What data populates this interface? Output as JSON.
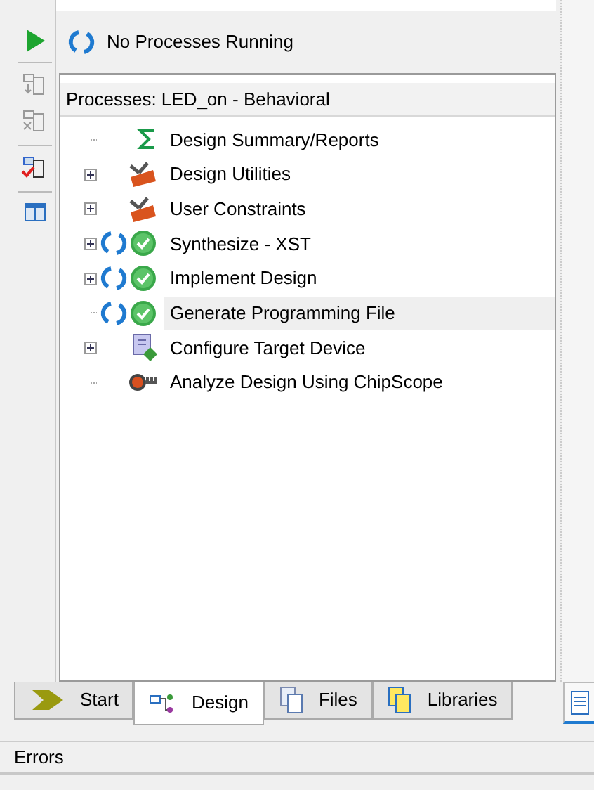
{
  "status": {
    "text": "No Processes Running"
  },
  "processes": {
    "title": "Processes:",
    "design": "LED_on - Behavioral",
    "items": [
      {
        "label": "Design Summary/Reports",
        "kind": "summary",
        "expandable": false,
        "selected": false
      },
      {
        "label": "Design Utilities",
        "kind": "tools",
        "expandable": true,
        "selected": false
      },
      {
        "label": "User Constraints",
        "kind": "tools",
        "expandable": true,
        "selected": false
      },
      {
        "label": "Synthesize - XST",
        "kind": "done",
        "expandable": true,
        "selected": false
      },
      {
        "label": "Implement Design",
        "kind": "done",
        "expandable": true,
        "selected": false
      },
      {
        "label": "Generate Programming File",
        "kind": "done",
        "expandable": false,
        "selected": true
      },
      {
        "label": "Configure Target Device",
        "kind": "device",
        "expandable": true,
        "selected": false
      },
      {
        "label": "Analyze Design Using ChipScope",
        "kind": "probe",
        "expandable": false,
        "selected": false
      }
    ]
  },
  "tabs": [
    {
      "label": "Start",
      "kind": "start",
      "selected": false
    },
    {
      "label": "Design",
      "kind": "design",
      "selected": true
    },
    {
      "label": "Files",
      "kind": "files",
      "selected": false
    },
    {
      "label": "Libraries",
      "kind": "libraries",
      "selected": false
    }
  ],
  "bottom_panel": {
    "title": "Errors"
  }
}
